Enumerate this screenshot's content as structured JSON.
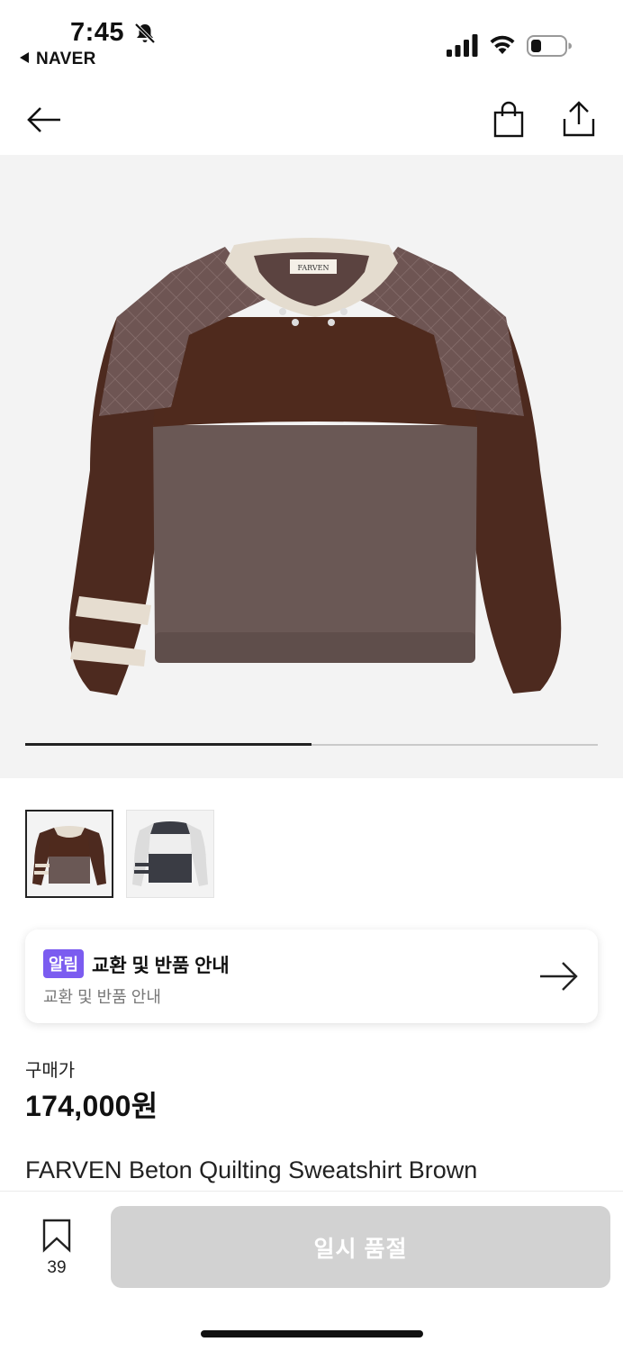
{
  "status_bar": {
    "time": "7:45",
    "back_app": "NAVER",
    "icons": [
      "bell-off-icon",
      "signal-icon",
      "wifi-icon",
      "battery-icon"
    ]
  },
  "nav": {
    "icons": [
      "back-arrow-icon",
      "shopping-bag-icon",
      "share-icon"
    ]
  },
  "gallery": {
    "progress": 0.5,
    "thumbnails": [
      "brown-sweatshirt",
      "gray-sweatshirt"
    ],
    "active_index": 0,
    "label_on_garment": "FARVEN"
  },
  "notice": {
    "badge": "알림",
    "title": "교환 및 반품 안내",
    "subtitle": "교환 및 반품 안내"
  },
  "product": {
    "price_label": "구매가",
    "price": "174,000원",
    "name": "FARVEN Beton Quilting Sweatshirt Brown"
  },
  "bottom_bar": {
    "bookmark_count": "39",
    "soldout_label": "일시 품절"
  },
  "colors": {
    "accent_badge": "#7b5cf0",
    "soldout_button": "#d2d2d2"
  }
}
